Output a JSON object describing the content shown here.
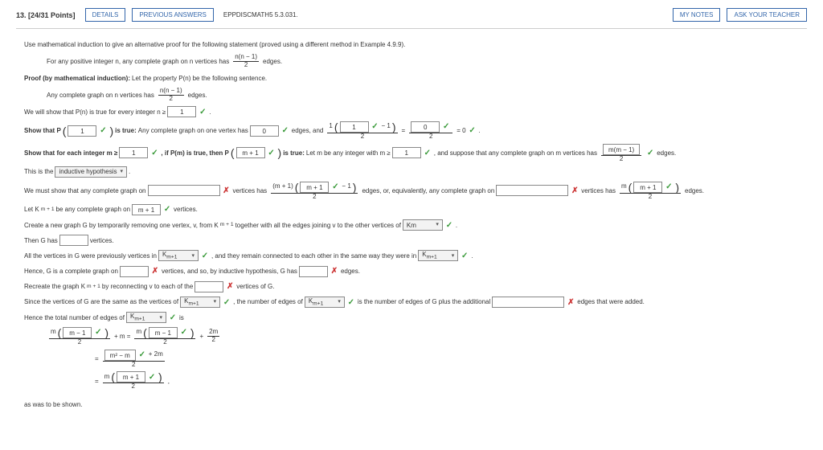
{
  "header": {
    "qnum": "13.",
    "points": "[24/31 Points]",
    "details": "DETAILS",
    "previous": "PREVIOUS ANSWERS",
    "ref": "EPPDISCMATH5 5.3.031.",
    "mynotes": "MY NOTES",
    "ask": "ASK YOUR TEACHER"
  },
  "body": {
    "intro": "Use mathematical induction to give an alternative proof for the following statement (proved using a different method in Example 4.9.9).",
    "stmt_pre": "For any positive integer n, any complete graph on n vertices has",
    "stmt_frac_num": "n(n − 1)",
    "stmt_frac_den": "2",
    "stmt_post": "edges.",
    "proof_head": "Proof (by mathematical induction):",
    "proof_sub": "Let the property P(n) be the following sentence.",
    "proof_prop_pre": "Any complete graph on n vertices has",
    "proof_prop_num": "n(n − 1)",
    "proof_prop_den": "2",
    "proof_prop_post": "edges.",
    "we_will": "We will show that P(n) is true for every integer n ≥",
    "one": "1",
    "show_that_p": "Show that P",
    "is_true1": "is true:",
    "true1_mid": "Any complete graph on one vertex has",
    "zero": "0",
    "edges_and": "edges, and",
    "eq_zero": "= 0",
    "show_each": "Show that for each integer m ≥",
    "if_pm": ", if P(m) is true, then P",
    "mp1": "m + 1",
    "is_true2": "is true:",
    "let_m": "Let m be any integer with m ≥",
    "suppose": ", and suppose that any complete graph on m vertices has",
    "frac_mm1_num": "m(m − 1)",
    "frac_mm1_den": "2",
    "edges": "edges.",
    "this_is": "This is the",
    "ind_hyp": "inductive hypothesis",
    "must_show": "We must show that any complete graph on",
    "vertices_has": "vertices has",
    "m1_top_pre": "(m + 1)",
    "m1_minus1": "− 1",
    "or_equiv": "edges, or, equivalently, any complete graph on",
    "vertices_has2": "vertices has",
    "m_open": "m",
    "let_k": "Let K",
    "km1_sub": "m + 1",
    "be_any": "be any complete graph on",
    "vertices_only": "vertices.",
    "create": "Create a new graph G by temporarily removing one vertex, v, from K",
    "together": "together with all the edges joining v to the other vertices of",
    "km": "Km",
    "then_g": "Then G has",
    "all_vert": "All the vertices in G were previously vertices in",
    "and_remain": ", and they remain connected to each other in the same way they were in",
    "hence": "Hence, G is a complete graph on",
    "vhyp": "vertices, and so, by inductive hypothesis, G has",
    "recreate": "Recreate the graph K",
    "reconnect": "by reconnecting v to each of the",
    "vertices_of_g": "vertices of G.",
    "since": "Since the vertices of G are the same as the vertices of",
    "num_edges_of": ", the number of edges of",
    "is_num": "is the number of edges of G plus the additional",
    "edges_added": "edges that were added.",
    "hence_total": "Hence the total number of edges of",
    "is_colon": "is",
    "mm1": "m − 1",
    "plus_m_eq": "+ m =",
    "plus": "+",
    "two_m_over2": "2m",
    "m2_m": "m² − m",
    "plus_2m": "+ 2m",
    "final_mp1": "m + 1",
    "as_was": "as was to be shown.",
    "period": " .",
    "comma": " ,",
    "equals_sign": "=",
    "two": "2",
    "edges_word": "edges."
  }
}
